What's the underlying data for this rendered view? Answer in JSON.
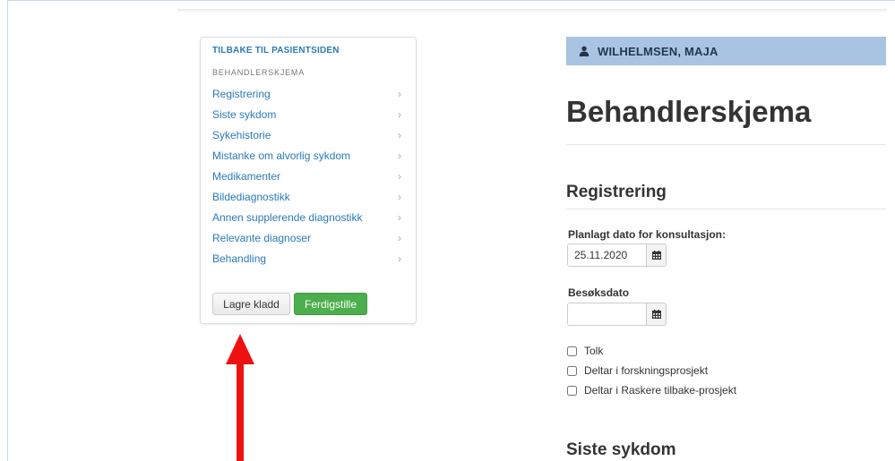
{
  "sidebar": {
    "back_link": "TILBAKE TIL PASIENTSIDEN",
    "section_label": "BEHANDLERSKJEMA",
    "items": [
      {
        "label": "Registrering"
      },
      {
        "label": "Siste sykdom"
      },
      {
        "label": "Sykehistorie"
      },
      {
        "label": "Mistanke om alvorlig sykdom"
      },
      {
        "label": "Medikamenter"
      },
      {
        "label": "Bildediagnostikk"
      },
      {
        "label": "Annen supplerende diagnostikk"
      },
      {
        "label": "Relevante diagnoser"
      },
      {
        "label": "Behandling"
      }
    ],
    "chevron": "›",
    "save_draft_label": "Lagre kladd",
    "finish_label": "Ferdigstille"
  },
  "patient": {
    "name": "WILHELMSEN, MAJA",
    "icon": "user-icon"
  },
  "main": {
    "page_title": "Behandlerskjema",
    "section_registrering": "Registrering",
    "planned_date_label": "Planlagt dato for konsultasjon:",
    "planned_date_value": "25.11.2020",
    "visit_date_label": "Besøksdato",
    "visit_date_value": "",
    "checkboxes": [
      {
        "label": "Tolk",
        "checked": false
      },
      {
        "label": "Deltar i forskningsprosjekt",
        "checked": false
      },
      {
        "label": "Deltar i Raskere tilbake-prosjekt",
        "checked": false
      }
    ],
    "section_siste_sykdom": "Siste sykdom"
  },
  "colors": {
    "link": "#2a7ab8",
    "patient_bar": "#a9c4e2",
    "finish_button": "#4cae4c",
    "annotation_arrow": "#ee1111"
  }
}
